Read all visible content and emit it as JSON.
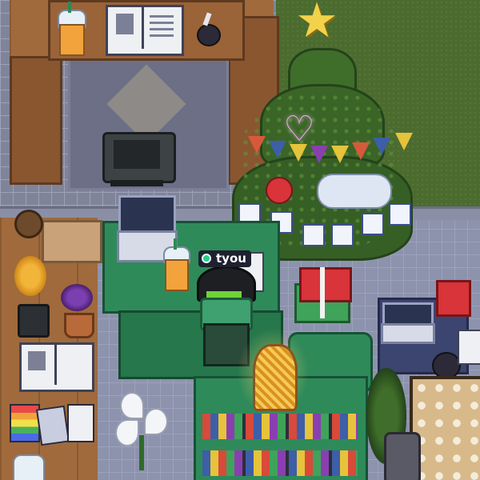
{
  "player": {
    "name": "tyou",
    "status": "online",
    "status_color": "#2ecc8e"
  },
  "scene": {
    "style": "pixel-art cozy room with christmas tree",
    "palette": {
      "wood": "#a06a3c",
      "grass": "#4c6b2f",
      "stone_floor": "#8e93ad",
      "desk_green": "#2f8a5a",
      "gift_red": "#d8343a"
    }
  },
  "objects": [
    {
      "kind": "christmas-tree",
      "icon": "tree-icon"
    },
    {
      "kind": "star",
      "icon": "star-icon"
    },
    {
      "kind": "heart-ornament",
      "icon": "heart-icon"
    },
    {
      "kind": "gift-box",
      "icon": "gift-icon"
    },
    {
      "kind": "laptop",
      "icon": "laptop-icon"
    },
    {
      "kind": "desk-lamp",
      "icon": "lamp-icon"
    },
    {
      "kind": "bookshelf",
      "icon": "bookshelf-icon"
    },
    {
      "kind": "office-chair",
      "icon": "chair-icon"
    },
    {
      "kind": "open-book",
      "icon": "book-icon"
    },
    {
      "kind": "flower-pot",
      "icon": "flower-icon"
    },
    {
      "kind": "bubble-tea",
      "icon": "drink-icon"
    },
    {
      "kind": "calla-lilies",
      "icon": "lily-icon"
    }
  ]
}
